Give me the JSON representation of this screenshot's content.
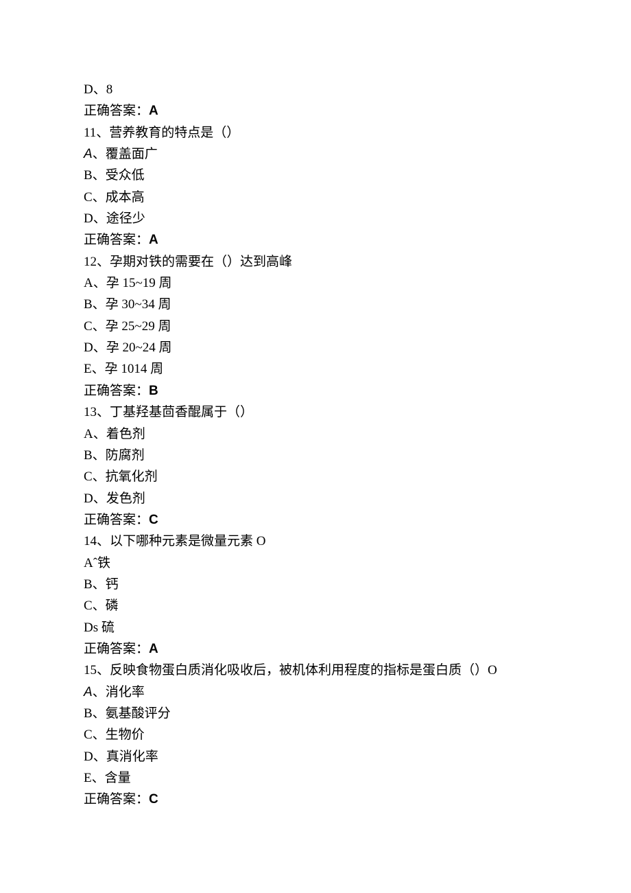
{
  "lines": {
    "q10_optD": "D、8",
    "q10_ans_label": "正确答案：",
    "q10_ans_letter": "A",
    "q11_stem": "11、营养教育的特点是（）",
    "q11_optA_letter": "A",
    "q11_optA_rest": "、覆盖面广",
    "q11_optB": "B、受众低",
    "q11_optC": "C、成本高",
    "q11_optD": "D、途径少",
    "q11_ans_label": "正确答案：",
    "q11_ans_letter": "A",
    "q12_stem": "12、孕期对铁的需要在（）达到高峰",
    "q12_optA": "A、孕 15~19 周",
    "q12_optB": "B、孕 30~34 周",
    "q12_optC": "C、孕 25~29 周",
    "q12_optD": "D、孕 20~24 周",
    "q12_optE": "E、孕 1014 周",
    "q12_ans_label": "正确答案：",
    "q12_ans_letter": "B",
    "q13_stem": "13、丁基羟基茴香醌属于（）",
    "q13_optA": "A、着色剂",
    "q13_optB": "B、防腐剂",
    "q13_optC": "C、抗氧化剂",
    "q13_optD": "D、发色剂",
    "q13_ans_label": "正确答案：",
    "q13_ans_letter": "C",
    "q14_stem": "14、以下哪种元素是微量元素 O",
    "q14_optA": "Aˆ铁",
    "q14_optB": "B、钙",
    "q14_optC": "C、磷",
    "q14_optD": "Ds 硫",
    "q14_ans_label": "正确答案：",
    "q14_ans_letter": "A",
    "q15_stem": "15、反映食物蛋白质消化吸收后，被机体利用程度的指标是蛋白质（）O",
    "q15_optA_letter": "A",
    "q15_optA_rest": "、消化率",
    "q15_optB": "B、氨基酸评分",
    "q15_optC": "C、生物价",
    "q15_optD": "D、真消化率",
    "q15_optE": "E、含量",
    "q15_ans_label": "正确答案：",
    "q15_ans_letter": "C"
  }
}
